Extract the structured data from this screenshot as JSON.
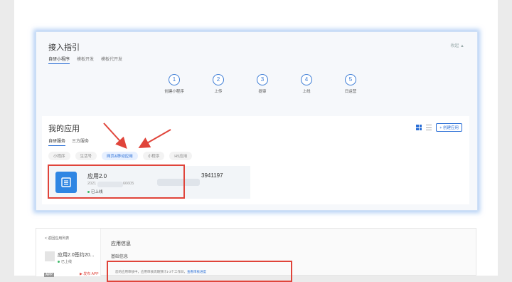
{
  "guide": {
    "title": "接入指引",
    "collapse": "收起 ▲",
    "tabs": [
      "自研小程序",
      "模板开发",
      "模板代开发"
    ],
    "steps": [
      {
        "num": "1",
        "label": "创建小程序"
      },
      {
        "num": "2",
        "label": "上传"
      },
      {
        "num": "3",
        "label": "提审"
      },
      {
        "num": "4",
        "label": "上线"
      },
      {
        "num": "5",
        "label": "日运营"
      }
    ]
  },
  "apps": {
    "title": "我的应用",
    "tabs": [
      "自研服务",
      "三方服务"
    ],
    "create_button": "+ 创建应用",
    "chips": [
      "小程序",
      "生活号",
      "网页&移动应用",
      "小程序",
      "H5应用"
    ],
    "card": {
      "name": "应用2.0",
      "id_suffix": "3941197",
      "id_prefix": "2021",
      "id_tail": "66605",
      "status": "已上线"
    }
  },
  "bottom": {
    "back": "< 返回应用列表",
    "app_name": "应用2.0签约20...",
    "app_status": "已上线",
    "app_info": "应用信息",
    "basic_info": "基础信息",
    "notice": "您的应用审核中，应用审核周期预计1-3个工作日，",
    "notice_link": "查看审核进度",
    "pub_tag": "▶ 发布 APP"
  },
  "colors": {
    "accent": "#2b6fd6",
    "highlight": "#e0443a",
    "status_green": "#3fb96a"
  }
}
